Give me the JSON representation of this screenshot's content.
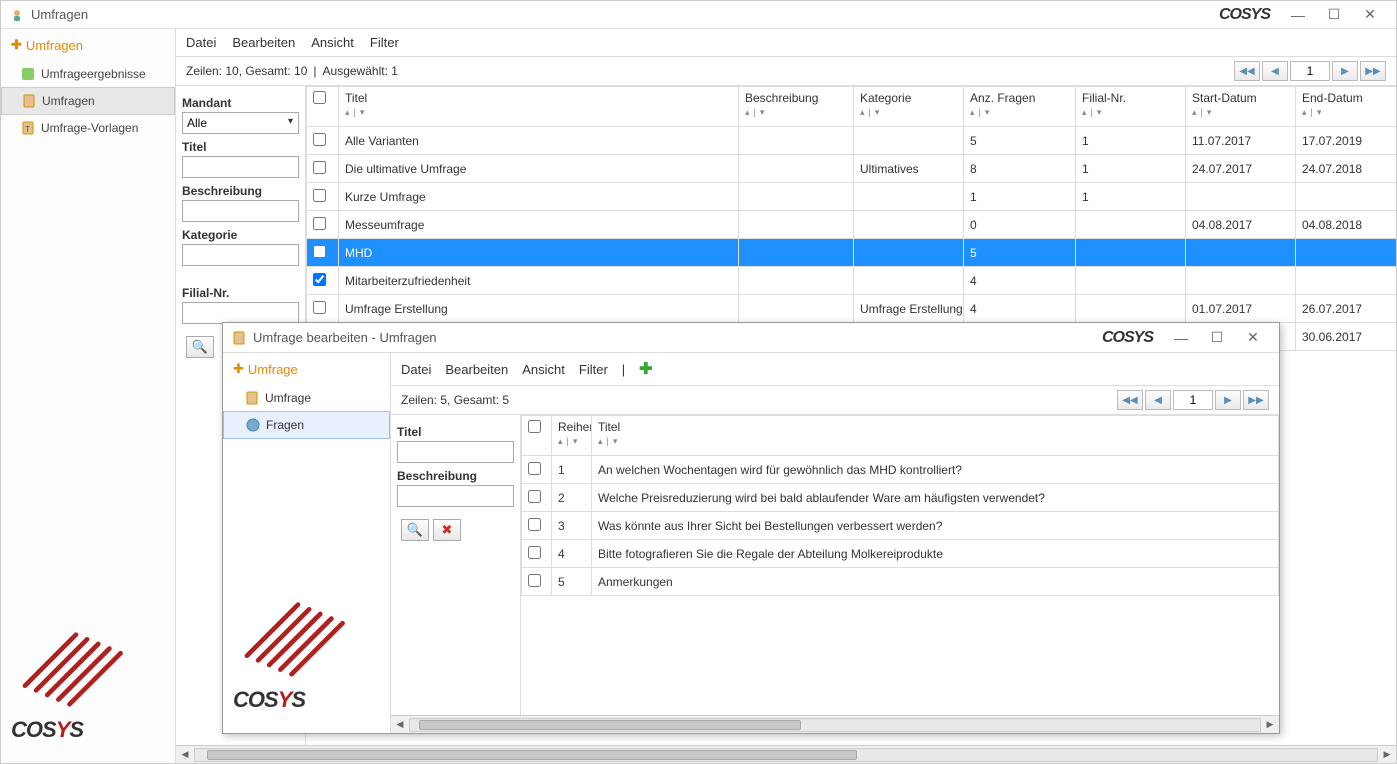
{
  "main_window": {
    "title": "Umfragen",
    "logo": "COSYS",
    "menubar": {
      "datei": "Datei",
      "bearbeiten": "Bearbeiten",
      "ansicht": "Ansicht",
      "filter": "Filter"
    },
    "status": {
      "zeilen": "Zeilen: 10, Gesamt: 10",
      "separator": "|",
      "ausgewahlt": "Ausgewählt: 1",
      "page": "1"
    },
    "sidebar": {
      "header": "Umfragen",
      "items": [
        {
          "label": "Umfrageergebnisse"
        },
        {
          "label": "Umfragen"
        },
        {
          "label": "Umfrage-Vorlagen"
        }
      ]
    },
    "filters": {
      "mandant_label": "Mandant",
      "mandant_value": "Alle",
      "titel_label": "Titel",
      "titel_value": "",
      "beschreibung_label": "Beschreibung",
      "beschreibung_value": "",
      "kategorie_label": "Kategorie",
      "kategorie_value": "",
      "filial_label": "Filial-Nr.",
      "filial_value": ""
    },
    "columns": {
      "titel": "Titel",
      "beschreibung": "Beschreibung",
      "kategorie": "Kategorie",
      "anz": "Anz. Fragen",
      "filial": "Filial-Nr.",
      "start": "Start-Datum",
      "end": "End-Datum"
    },
    "rows": [
      {
        "checked": false,
        "titel": "Alle Varianten",
        "beschreibung": "",
        "kategorie": "",
        "anz": "5",
        "filial": "1",
        "start": "11.07.2017",
        "end": "17.07.2019",
        "selected": false
      },
      {
        "checked": false,
        "titel": "Die ultimative Umfrage",
        "beschreibung": "",
        "kategorie": "Ultimatives",
        "anz": "8",
        "filial": "1",
        "start": "24.07.2017",
        "end": "24.07.2018",
        "selected": false
      },
      {
        "checked": false,
        "titel": "Kurze Umfrage",
        "beschreibung": "",
        "kategorie": "",
        "anz": "1",
        "filial": "1",
        "start": "",
        "end": "",
        "selected": false
      },
      {
        "checked": false,
        "titel": "Messeumfrage",
        "beschreibung": "",
        "kategorie": "",
        "anz": "0",
        "filial": "",
        "start": "04.08.2017",
        "end": "04.08.2018",
        "selected": false
      },
      {
        "checked": false,
        "titel": "MHD",
        "beschreibung": "",
        "kategorie": "",
        "anz": "5",
        "filial": "",
        "start": "",
        "end": "",
        "selected": true
      },
      {
        "checked": true,
        "titel": "Mitarbeiterzufriedenheit",
        "beschreibung": "",
        "kategorie": "",
        "anz": "4",
        "filial": "",
        "start": "",
        "end": "",
        "selected": false
      },
      {
        "checked": false,
        "titel": "Umfrage Erstellung",
        "beschreibung": "",
        "kategorie": "Umfrage Erstellung",
        "anz": "4",
        "filial": "",
        "start": "01.07.2017",
        "end": "26.07.2017",
        "selected": false
      },
      {
        "checked": false,
        "titel": "",
        "beschreibung": "",
        "kategorie": "",
        "anz": "",
        "filial": "",
        "start": "",
        "end": "30.06.2017",
        "selected": false
      }
    ]
  },
  "dialog": {
    "title": "Umfrage bearbeiten - Umfragen",
    "logo": "COSYS",
    "sidebar": {
      "header": "Umfrage",
      "items": [
        {
          "label": "Umfrage"
        },
        {
          "label": "Fragen"
        }
      ]
    },
    "menubar": {
      "datei": "Datei",
      "bearbeiten": "Bearbeiten",
      "ansicht": "Ansicht",
      "filter": "Filter"
    },
    "status": {
      "zeilen": "Zeilen: 5, Gesamt: 5",
      "page": "1"
    },
    "filters": {
      "titel_label": "Titel",
      "titel_value": "",
      "beschreibung_label": "Beschreibung",
      "beschreibung_value": ""
    },
    "columns": {
      "reihen": "Reihen",
      "titel": "Titel"
    },
    "rows": [
      {
        "checked": false,
        "reihen": "1",
        "titel": "An welchen Wochentagen wird für gewöhnlich das MHD kontrolliert?"
      },
      {
        "checked": false,
        "reihen": "2",
        "titel": "Welche Preisreduzierung wird bei bald ablaufender Ware am häufigsten verwendet?"
      },
      {
        "checked": false,
        "reihen": "3",
        "titel": "Was könnte aus Ihrer Sicht bei Bestellungen verbessert werden?"
      },
      {
        "checked": false,
        "reihen": "4",
        "titel": "Bitte fotografieren Sie die Regale der Abteilung Molkereiprodukte"
      },
      {
        "checked": false,
        "reihen": "5",
        "titel": "Anmerkungen"
      }
    ]
  }
}
